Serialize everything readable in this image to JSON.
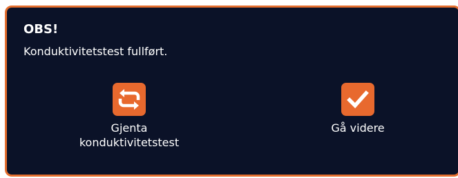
{
  "dialog": {
    "title": "OBS!",
    "message": "Konduktivitetstest fullført."
  },
  "actions": {
    "retry": {
      "icon": "refresh-icon",
      "label_line1": "Gjenta",
      "label_line2": "konduktivitetstest"
    },
    "continue": {
      "icon": "checkmark-icon",
      "label": "Gå videre"
    }
  },
  "colors": {
    "background": "#0b1228",
    "accent": "#e8692e",
    "border": "#e46f2f",
    "text": "#ffffff"
  }
}
